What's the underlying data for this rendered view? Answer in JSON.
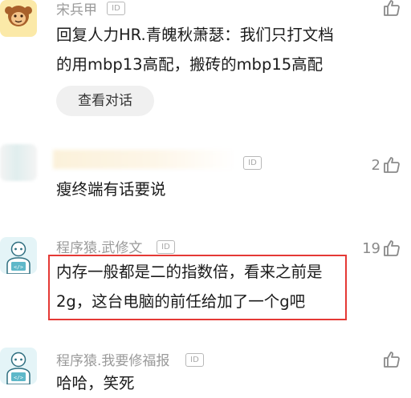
{
  "badge_label": "ID",
  "comments": [
    {
      "username": "宋兵甲",
      "text_lines": [
        "回复人力HR.青魄秋萧瑟：我们只打文档",
        "的用mbp13高配，搬砖的mbp15高配"
      ],
      "button_label": "查看对话",
      "like_count": ""
    },
    {
      "username": "",
      "text_lines": [
        "瘦终端有话要说"
      ],
      "like_count": "2"
    },
    {
      "username": "程序猿.武修文",
      "text_lines": [
        "内存一般都是二的指数倍，看来之前是",
        "2g，这台电脑的前任给加了一个g吧"
      ],
      "like_count": "19",
      "highlighted": true
    },
    {
      "username": "程序猿.我要修福报",
      "text_lines": [
        "哈哈，笑死"
      ],
      "like_count": ""
    }
  ],
  "colors": {
    "highlight_border": "#e53935",
    "username": "#9a9a9a",
    "avatar_coder_bg": "#e4f4f7"
  },
  "icons": [
    "monkey-avatar",
    "coder-avatar",
    "thumbs-up-icon"
  ]
}
